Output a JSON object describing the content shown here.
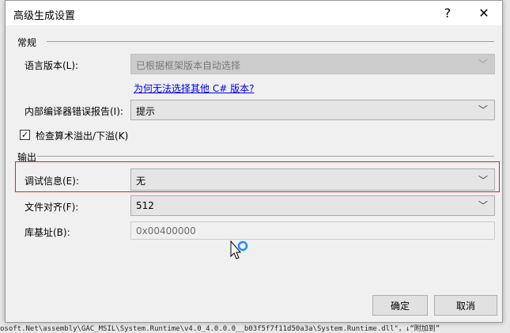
{
  "background_text": "osoft.Net\\assembly\\GAC_MSIL\\System.Runtime\\v4.0_4.0.0.0__b03f5f7f11d50a3a\\System.Runtime.dll\"，↓“附加到”",
  "dialog": {
    "title": "高级生成设置",
    "help": "?",
    "close": "✕"
  },
  "general": {
    "header": "常规",
    "language_label": "语言版本(L):",
    "language_value": "已根据框架版本自动选择",
    "link": "为何无法选择其他 C# 版本?",
    "error_label": "内部编译器错误报告(I):",
    "error_value": "提示",
    "overflow_label": "检查算术溢出/下溢(K)",
    "overflow_checked": true
  },
  "output": {
    "header": "输出",
    "debug_label": "调试信息(E):",
    "debug_value": "无",
    "align_label": "文件对齐(F):",
    "align_value": "512",
    "base_label": "库基址(B):",
    "base_value": "0x00400000"
  },
  "buttons": {
    "ok": "确定",
    "cancel": "取消"
  }
}
